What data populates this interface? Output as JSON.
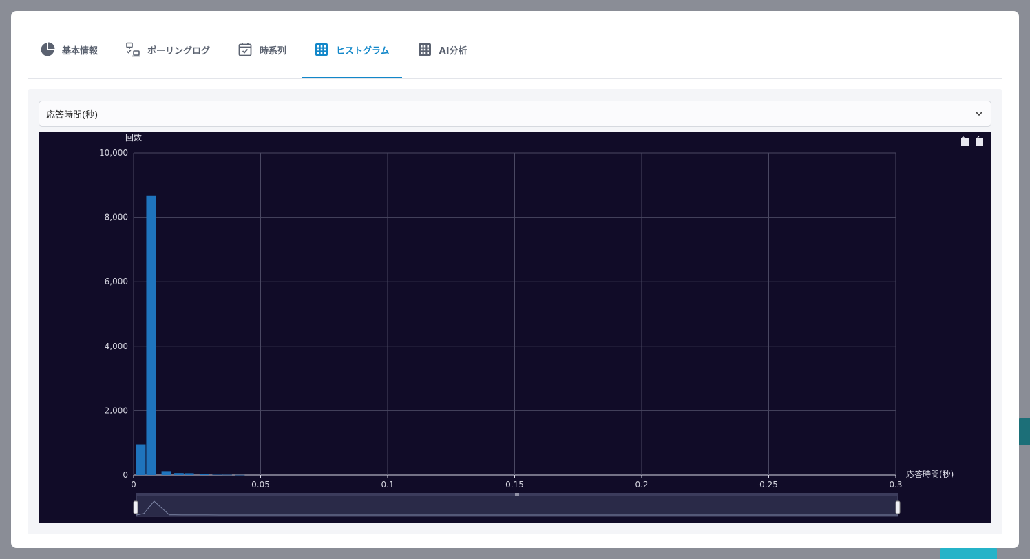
{
  "tabs": [
    {
      "label": "基本情報",
      "icon": "pie-chart-icon"
    },
    {
      "label": "ポーリングログ",
      "icon": "network-icon"
    },
    {
      "label": "時系列",
      "icon": "calendar-check-icon"
    },
    {
      "label": "ヒストグラム",
      "icon": "grid-icon",
      "active": true
    },
    {
      "label": "AI分析",
      "icon": "grid-icon"
    }
  ],
  "metric_select": {
    "value": "応答時間(秒)"
  },
  "chart_data": {
    "type": "bar",
    "xlabel": "応答時間(秒)",
    "ylabel": "回数",
    "xlim": [
      0,
      0.3
    ],
    "ylim": [
      0,
      10000
    ],
    "x_ticks": [
      0,
      0.05,
      0.1,
      0.15,
      0.2,
      0.25,
      0.3
    ],
    "x_tick_labels": [
      "0",
      "0.05",
      "0.1",
      "0.15",
      "0.2",
      "0.25",
      "0.3"
    ],
    "y_ticks": [
      0,
      2000,
      4000,
      6000,
      8000,
      10000
    ],
    "y_tick_labels": [
      "0",
      "2,000",
      "4,000",
      "6,000",
      "8,000",
      "10,000"
    ],
    "bin_width": 0.004,
    "bins": [
      {
        "start": 0.001,
        "count": 950
      },
      {
        "start": 0.005,
        "count": 8680
      },
      {
        "start": 0.011,
        "count": 120
      },
      {
        "start": 0.016,
        "count": 60
      },
      {
        "start": 0.02,
        "count": 55
      },
      {
        "start": 0.026,
        "count": 30
      },
      {
        "start": 0.031,
        "count": 10
      },
      {
        "start": 0.035,
        "count": 8
      },
      {
        "start": 0.04,
        "count": 3
      }
    ],
    "grid": true,
    "bar_color": "#1f74bd",
    "background": "#110c28",
    "data_zoom": {
      "start": 0,
      "end": 0.3
    },
    "toolbox_icons": [
      "zoom-in-icon",
      "zoom-reset-icon"
    ]
  }
}
